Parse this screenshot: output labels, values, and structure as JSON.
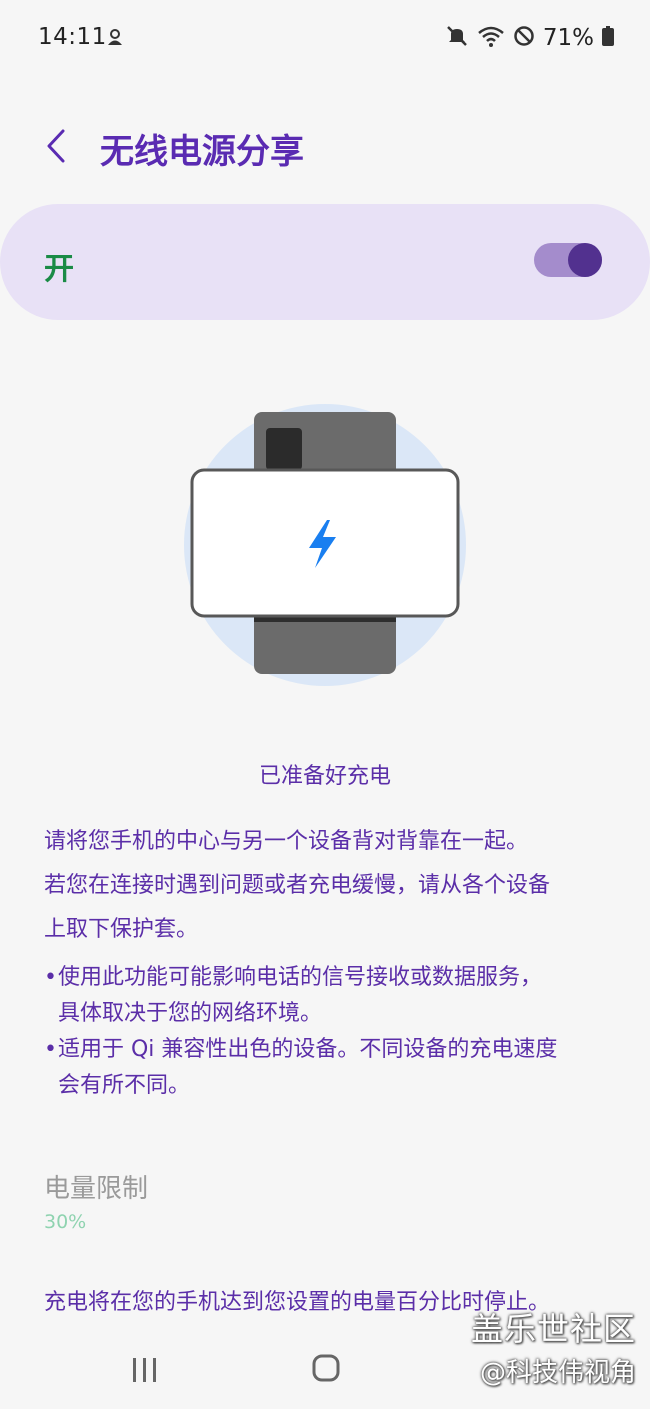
{
  "status_bar": {
    "time": "14:11",
    "battery": "71%",
    "icons": [
      "notification-app-icon",
      "mute-icon",
      "wifi-icon",
      "do-not-disturb-icon",
      "battery-icon"
    ]
  },
  "header": {
    "back_icon": "chevron-left-icon",
    "title": "无线电源分享"
  },
  "master_switch": {
    "label": "开",
    "state": "on"
  },
  "illustration": {
    "icon": "lightning-bolt-icon",
    "accent_color": "#1a7ff0"
  },
  "ready_text": "已准备好充电",
  "instructions": [
    "请将您手机的中心与另一个设备背对背靠在一起。",
    "若您在连接时遇到问题或者充电缓慢，请从各个设备",
    "上取下保护套。"
  ],
  "notes": [
    {
      "bullet": "•",
      "lines": [
        "使用此功能可能影响电话的信号接收或数据服务，",
        "具体取决于您的网络环境。"
      ]
    },
    {
      "bullet": "•",
      "lines": [
        "适用于 Qi 兼容性出色的设备。不同设备的充电速度",
        "会有所不同。"
      ]
    }
  ],
  "battery_limit": {
    "title": "电量限制",
    "value": "30%"
  },
  "footer_note": "充电将在您的手机达到您设置的电量百分比时停止。",
  "nav_bar": {
    "recent_icon": "recent-apps-icon",
    "home_icon": "home-icon"
  },
  "watermark": {
    "line1": "盖乐世社区",
    "line2": "@科技伟视角"
  },
  "colors": {
    "accent": "#5a2bb2",
    "on_label": "#1a8b46",
    "switch_bg": "#e8e1f6"
  }
}
